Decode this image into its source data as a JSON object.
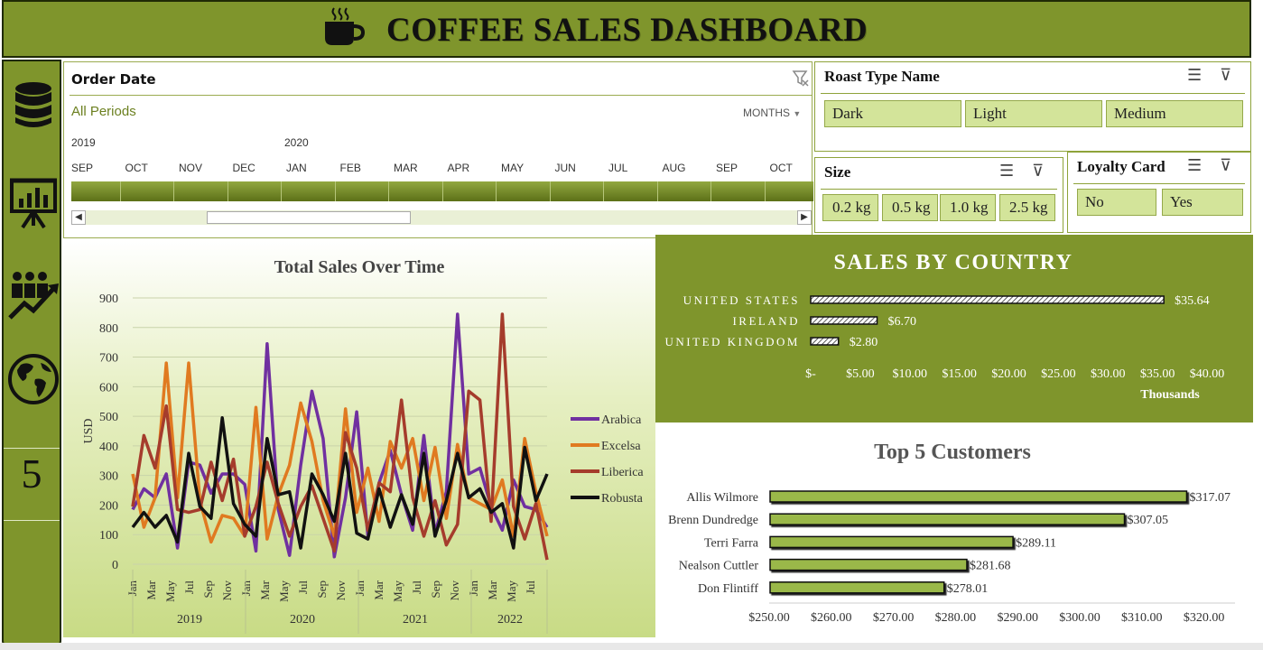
{
  "header": {
    "title": "COFFEE SALES DASHBOARD",
    "icon": "coffee-cup-icon",
    "color": "#7f952c"
  },
  "sidebar": {
    "icons": [
      "database-icon",
      "presentation-chart-icon",
      "team-growth-icon",
      "globe-icon"
    ],
    "number": "5"
  },
  "timeline": {
    "title": "Order Date",
    "all_periods": "All Periods",
    "level": "MONTHS",
    "years": [
      "2019",
      "2020"
    ],
    "months": [
      "SEP",
      "OCT",
      "NOV",
      "DEC",
      "JAN",
      "FEB",
      "MAR",
      "APR",
      "MAY",
      "JUN",
      "JUL",
      "AUG",
      "SEP",
      "OCT"
    ]
  },
  "slicers": {
    "roast": {
      "title": "Roast Type Name",
      "options": [
        "Dark",
        "Light",
        "Medium"
      ]
    },
    "size": {
      "title": "Size",
      "options": [
        "0.2 kg",
        "0.5 kg",
        "1.0 kg",
        "2.5 kg"
      ]
    },
    "loyalty": {
      "title": "Loyalty Card",
      "options": [
        "No",
        "Yes"
      ]
    }
  },
  "chart_data": [
    {
      "type": "line",
      "title": "Total Sales Over Time",
      "ylabel": "USD",
      "ylim": [
        0,
        900
      ],
      "yticks": [
        0,
        100,
        200,
        300,
        400,
        500,
        600,
        700,
        800,
        900
      ],
      "month_labels": [
        "Jan",
        "Mar",
        "May",
        "Jul",
        "Sep",
        "Nov",
        "Jan",
        "Mar",
        "May",
        "Jul",
        "Sep",
        "Nov",
        "Jan",
        "Mar",
        "May",
        "Jul",
        "Sep",
        "Nov",
        "Jan",
        "Mar",
        "May",
        "Jul"
      ],
      "years": [
        "2019",
        "2020",
        "2021",
        "2022"
      ],
      "legend": "right",
      "series": [
        {
          "name": "Arabica",
          "color": "#7030a0",
          "values": [
            185,
            255,
            225,
            305,
            55,
            345,
            335,
            240,
            305,
            305,
            270,
            45,
            745,
            185,
            30,
            335,
            585,
            425,
            25,
            225,
            515,
            95,
            275,
            385,
            235,
            115,
            435,
            105,
            245,
            845,
            305,
            325,
            195,
            115,
            285,
            195,
            185,
            125
          ]
        },
        {
          "name": "Excelsa",
          "color": "#e07a20",
          "values": [
            305,
            125,
            225,
            680,
            225,
            680,
            215,
            75,
            165,
            155,
            95,
            530,
            85,
            235,
            335,
            545,
            415,
            215,
            95,
            525,
            175,
            325,
            145,
            415,
            325,
            425,
            215,
            395,
            155,
            405,
            225,
            205,
            185,
            285,
            95,
            425,
            245,
            95
          ]
        },
        {
          "name": "Liberica",
          "color": "#a53c2c",
          "values": [
            195,
            435,
            325,
            535,
            185,
            175,
            185,
            345,
            215,
            355,
            95,
            195,
            345,
            205,
            95,
            195,
            265,
            155,
            45,
            445,
            325,
            115,
            275,
            245,
            555,
            225,
            95,
            215,
            65,
            135,
            585,
            555,
            145,
            845,
            195,
            85,
            205,
            15
          ]
        },
        {
          "name": "Robusta",
          "color": "#111111",
          "values": [
            125,
            175,
            125,
            165,
            75,
            375,
            195,
            155,
            495,
            205,
            135,
            95,
            425,
            235,
            245,
            55,
            305,
            235,
            145,
            375,
            105,
            85,
            255,
            125,
            235,
            135,
            375,
            95,
            215,
            375,
            225,
            255,
            175,
            205,
            55,
            395,
            215,
            305
          ]
        }
      ]
    },
    {
      "type": "bar",
      "title": "SALES BY COUNTRY",
      "categories": [
        "UNITED STATES",
        "IRELAND",
        "UNITED KINGDOM"
      ],
      "values": [
        35.64,
        6.7,
        2.8
      ],
      "value_labels": [
        "$35.64",
        "$6.70",
        "$2.80"
      ],
      "xlim": [
        0,
        40
      ],
      "xticks": [
        "$-",
        "$5.00",
        "$10.00",
        "$15.00",
        "$20.00",
        "$25.00",
        "$30.00",
        "$35.00",
        "$40.00"
      ],
      "xlabel": "Thousands"
    },
    {
      "type": "bar",
      "title": "Top 5 Customers",
      "categories": [
        "Allis Wilmore",
        "Brenn Dundredge",
        "Terri Farra",
        "Nealson Cuttler",
        "Don Flintiff"
      ],
      "values": [
        317.07,
        307.05,
        289.11,
        281.68,
        278.01
      ],
      "value_labels": [
        "$317.07",
        "$307.05",
        "$289.11",
        "$281.68",
        "$278.01"
      ],
      "xlim": [
        250,
        325
      ],
      "xticks": [
        "$250.00",
        "$260.00",
        "$270.00",
        "$280.00",
        "$290.00",
        "$300.00",
        "$310.00",
        "$320.00"
      ],
      "bar_color": "#9ab84a"
    }
  ]
}
